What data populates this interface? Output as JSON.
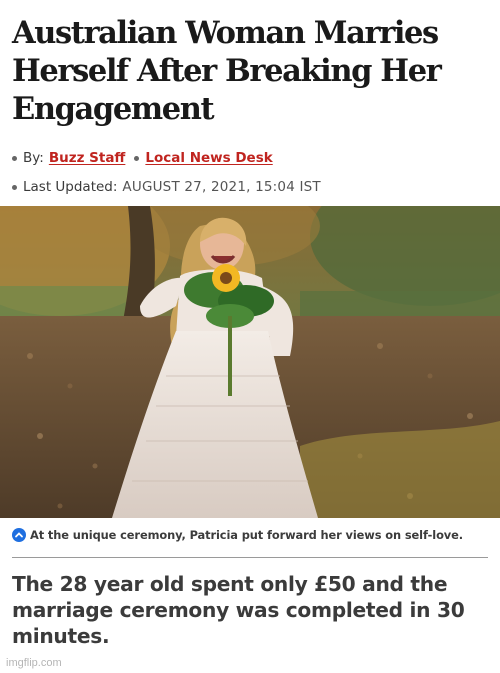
{
  "article": {
    "headline": "Australian Woman Marries Herself After Breaking Her Engagement",
    "byline_label": "By:",
    "author": "Buzz Staff",
    "desk": "Local News Desk",
    "updated_label": "Last Updated:",
    "updated_value": "AUGUST 27, 2021, 15:04 IST",
    "caption": "At the unique ceremony, Patricia put forward her views on self-love.",
    "summary": "The 28 year old spent only £50 and the marriage ceremony was completed in 30 minutes."
  },
  "icons": {
    "bullet": "bullet-dot-icon",
    "caption_toggle": "chevron-up-icon"
  },
  "colors": {
    "link": "#c0241f",
    "caption_icon": "#1f6fe0"
  },
  "watermark": "imgflip.com"
}
